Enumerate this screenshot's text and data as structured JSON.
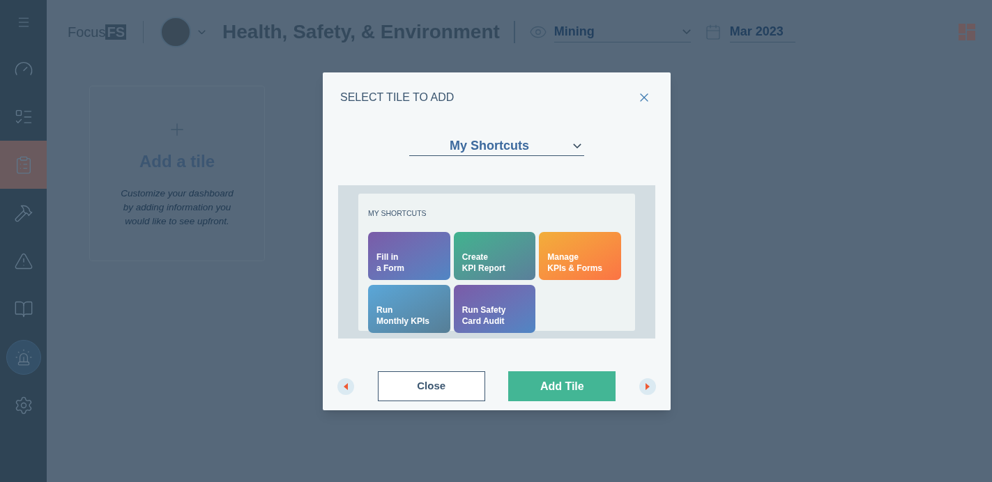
{
  "sidebar": {
    "items": [
      {
        "kind": "menu",
        "selected": false
      },
      {
        "kind": "dashboard",
        "selected": false
      },
      {
        "kind": "list",
        "selected": false
      },
      {
        "kind": "checklist",
        "selected": true
      },
      {
        "kind": "tools",
        "selected": false
      },
      {
        "kind": "hazard",
        "selected": false
      },
      {
        "kind": "manual",
        "selected": false
      },
      {
        "kind": "alarm",
        "selected": false
      },
      {
        "kind": "settings",
        "selected": false
      }
    ]
  },
  "header": {
    "logo_text": "Focus",
    "logo_badge": "FS",
    "title": "Health, Safety, & Environment",
    "view": {
      "value": "Mining"
    },
    "date": {
      "value": "Mar 2023"
    }
  },
  "add_tile_card": {
    "title": "Add a tile",
    "description": "Customize your dashboard by adding information you would like to see upfront."
  },
  "dialog": {
    "title": "SELECT TILE TO ADD",
    "category": {
      "value": "My Shortcuts"
    },
    "preview": {
      "heading": "MY SHORTCUTS",
      "tiles": [
        {
          "line1": "Fill in",
          "line2": "a Form",
          "kind": "purple"
        },
        {
          "line1": "Create",
          "line2": "KPI Report",
          "kind": "teal"
        },
        {
          "line1": "Manage",
          "line2": "KPIs & Forms",
          "kind": "orange"
        },
        {
          "line1": "Run",
          "line2": "Monthly KPIs",
          "kind": "blue"
        },
        {
          "line1": "Run Safety",
          "line2": "Card Audit",
          "kind": "purple"
        }
      ]
    },
    "buttons": {
      "close": "Close",
      "add": "Add Tile"
    }
  }
}
